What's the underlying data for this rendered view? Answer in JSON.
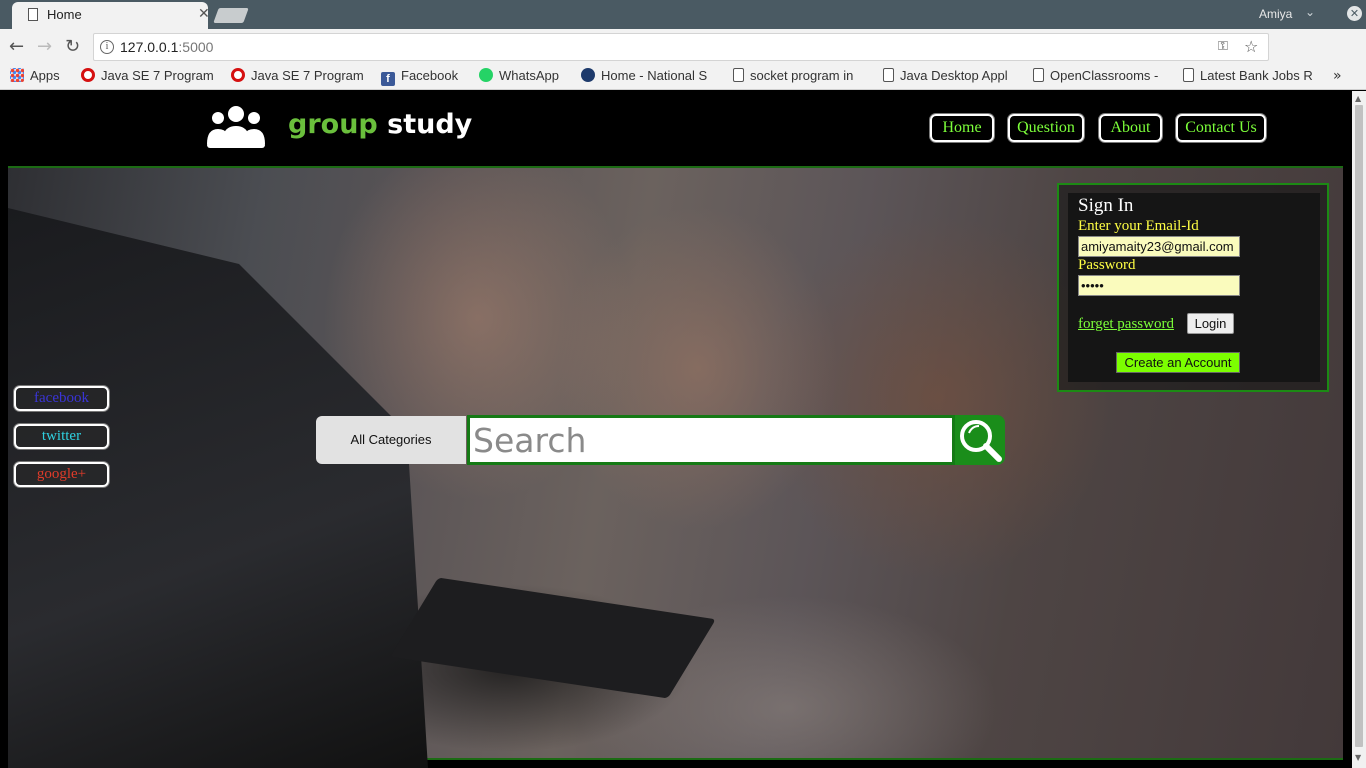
{
  "browser": {
    "tab_title": "Home",
    "profile_name": "Amiya",
    "url_host": "127.0.0.1",
    "url_port": ":5000",
    "bookmarks": [
      {
        "label": "Apps",
        "icon": "apps-grid-icon"
      },
      {
        "label": "Java SE 7 Program",
        "icon": "oracle-icon"
      },
      {
        "label": "Java SE 7 Program",
        "icon": "oracle-icon"
      },
      {
        "label": "Facebook",
        "icon": "facebook-icon"
      },
      {
        "label": "WhatsApp",
        "icon": "whatsapp-icon"
      },
      {
        "label": "Home - National S",
        "icon": "site-icon"
      },
      {
        "label": "socket program in",
        "icon": "document-icon"
      },
      {
        "label": "Java Desktop Appl",
        "icon": "document-icon"
      },
      {
        "label": "OpenClassrooms -",
        "icon": "document-icon"
      },
      {
        "label": "Latest Bank Jobs R",
        "icon": "document-icon"
      }
    ]
  },
  "header": {
    "brand_part1": "group",
    "brand_part2": "study",
    "nav": [
      "Home",
      "Question",
      "About",
      "Contact Us"
    ],
    "nav_color": "#7cff3a"
  },
  "social": [
    "facebook",
    "twitter",
    "google+"
  ],
  "social_colors": [
    "#3a34d6",
    "#2fd1e0",
    "#e03b2a"
  ],
  "search": {
    "category": "All Categories",
    "placeholder": "Search"
  },
  "signin": {
    "title": "Sign In",
    "email_label": "Enter your Email-Id",
    "email_value": "amiyamaity23@gmail.com",
    "password_label": "Password",
    "password_value": "•••••",
    "forgot_label": "forget password",
    "login_label": "Login",
    "create_label": "Create an Account"
  }
}
